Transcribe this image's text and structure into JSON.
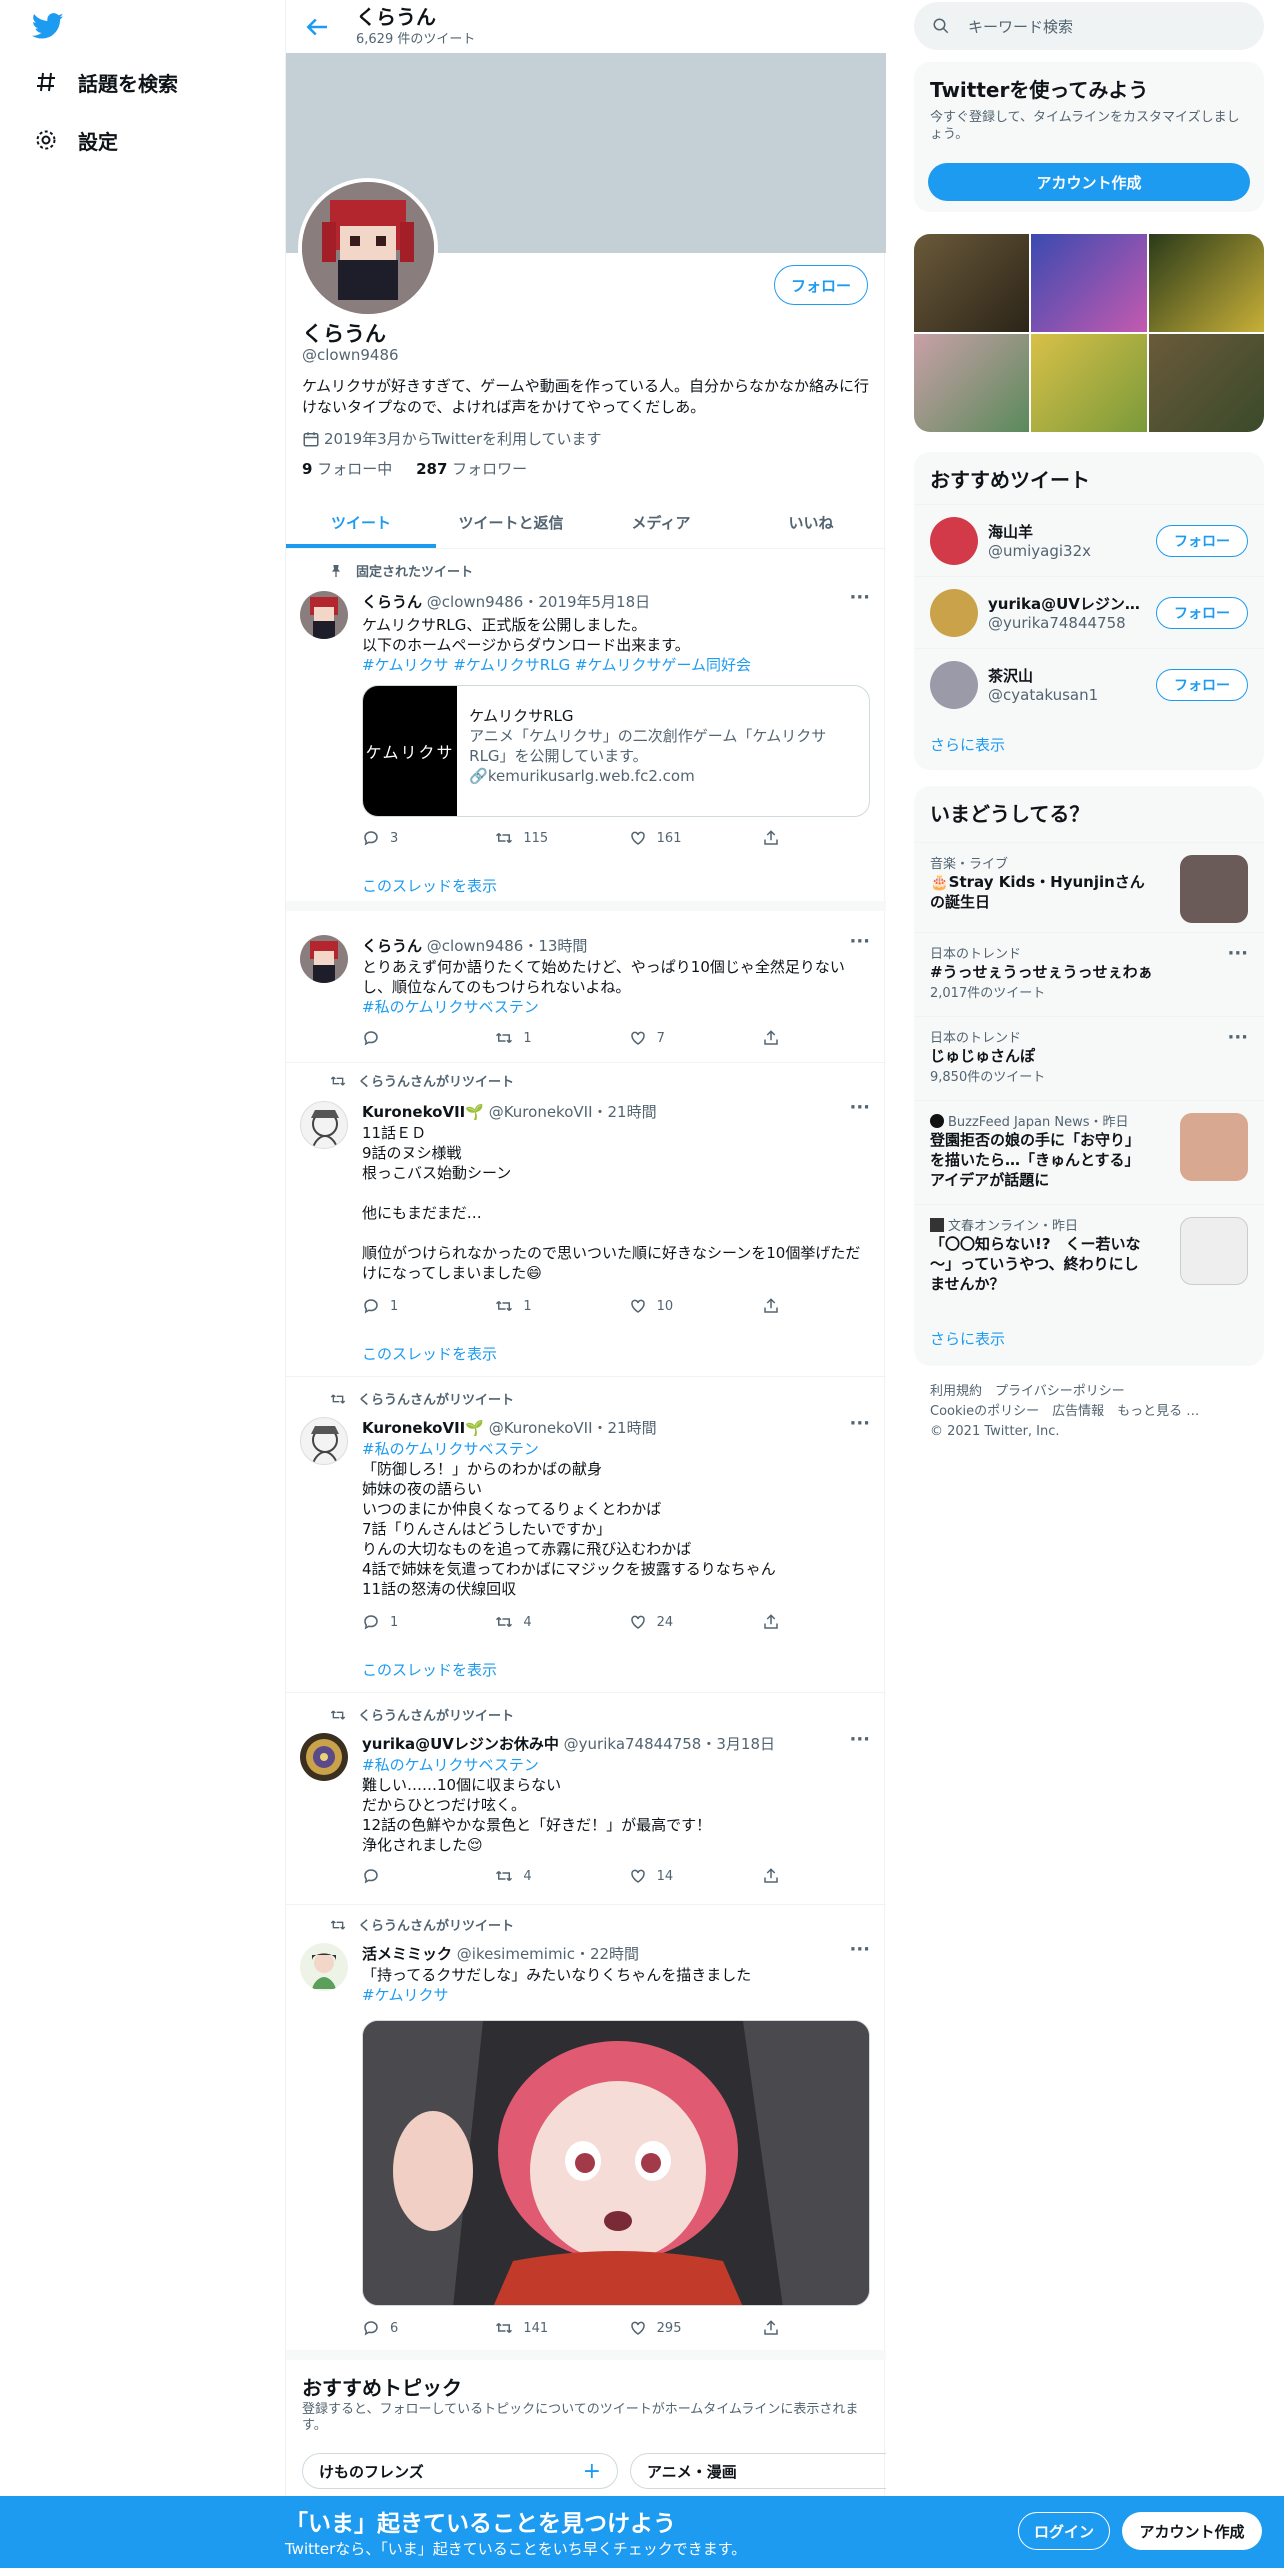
{
  "nav": {
    "explore_label": "話題を検索",
    "settings_label": "設定"
  },
  "profile_header": {
    "name": "くらうん",
    "tweet_count": "6,629 件のツイート"
  },
  "profile": {
    "follow_label": "フォロー",
    "name": "くらうん",
    "handle": "@clown9486",
    "bio": "ケムリクサが好きすぎて、ゲームや動画を作っている人。自分からなかなか絡みに行けないタイプなので、よければ声をかけてやってくだしあ。",
    "joined": "2019年3月からTwitterを利用しています",
    "following_count": "9",
    "following_label": "フォロー中",
    "followers_count": "287",
    "followers_label": "フォロワー"
  },
  "tabs": [
    "ツイート",
    "ツイートと返信",
    "メディア",
    "いいね"
  ],
  "tweets": [
    {
      "context": "固定されたツイート",
      "name": "くらうん",
      "meta": "@clown9486・2019年5月18日",
      "text": "ケムリクサRLG、正式版を公開しました。\n以下のホームページからダウンロード出来ます。",
      "tags": "#ケムリクサ #ケムリクサRLG #ケムリクサゲーム同好会",
      "card": {
        "img_text": "ケムリクサ",
        "title": "ケムリクサRLG",
        "desc": "アニメ「ケムリクサ」の二次創作ゲーム「ケムリクサRLG」を公開しています。",
        "url": "kemurikusarlg.web.fc2.com"
      },
      "replies": "3",
      "retweets": "115",
      "likes": "161",
      "thread": "このスレッドを表示"
    },
    {
      "name": "くらうん",
      "meta": "@clown9486・13時間",
      "text": "とりあえず何か語りたくて始めたけど、やっぱり10個じゃ全然足りないし、順位なんてのもつけられないよね。",
      "tags": "#私のケムリクサベステン",
      "replies": "",
      "retweets": "1",
      "likes": "7"
    },
    {
      "context": "くらうんさんがリツイート",
      "name": "KuronekoVII🌱",
      "meta": "@KuronekoVII・21時間",
      "text": "11話ＥＤ\n9話のヌシ様戦\n根っこバス始動シーン\n\n他にもまだまだ…\n\n順位がつけられなかったので思いついた順に好きなシーンを10個挙げただけになってしまいました😄",
      "replies": "1",
      "retweets": "1",
      "likes": "10",
      "thread": "このスレッドを表示"
    },
    {
      "context": "くらうんさんがリツイート",
      "name": "KuronekoVII🌱",
      "meta": "@KuronekoVII・21時間",
      "tags": "#私のケムリクサベステン",
      "text": "「防御しろ！」からのわかばの献身\n姉妹の夜の語らい\nいつのまにか仲良くなってるりょくとわかば\n7話「りんさんはどうしたいですか」\nりんの大切なものを追って赤霧に飛び込むわかば\n4話で姉妹を気遣ってわかばにマジックを披露するりなちゃん\n11話の怒涛の伏線回収",
      "replies": "1",
      "retweets": "4",
      "likes": "24",
      "thread": "このスレッドを表示"
    },
    {
      "context": "くらうんさんがリツイート",
      "name": "yurika@UVレジンお休み中",
      "meta": "@yurika74844758・3月18日",
      "tags": "#私のケムリクサベステン",
      "text": "難しい……10個に収まらない\nだからひとつだけ呟く。\n12話の色鮮やかな景色と「好きだ！」が最高です！\n浄化されました😌",
      "replies": "",
      "retweets": "4",
      "likes": "14"
    },
    {
      "context": "くらうんさんがリツイート",
      "name": "活メミミック",
      "meta": "@ikesimemimic・22時間",
      "text": "「持ってるクサだしな」みたいなりくちゃんを描きました",
      "tags": "#ケムリクサ",
      "replies": "6",
      "retweets": "141",
      "likes": "295"
    }
  ],
  "topics": {
    "title": "おすすめトピック",
    "subtitle": "登録すると、フォローしているトピックについてのツイートがホームタイムラインに表示されます。",
    "items": [
      "けものフレンズ",
      "アニメ・漫画"
    ]
  },
  "search": {
    "placeholder": "キーワード検索"
  },
  "signup": {
    "title": "Twitterを使ってみよう",
    "subtitle": "今すぐ登録して、タイムラインをカスタマイズしましょう。",
    "button": "アカウント作成"
  },
  "who_to_follow": {
    "title": "おすすめツイート",
    "users": [
      {
        "name": "海山羊",
        "handle": "@umiyagi32x"
      },
      {
        "name": "yurika@UVレジンお...",
        "handle": "@yurika74844758"
      },
      {
        "name": "茶沢山",
        "handle": "@cyatakusan1"
      }
    ],
    "follow_label": "フォロー",
    "show_more": "さらに表示"
  },
  "trends": {
    "title": "いまどうしてる？",
    "items": [
      {
        "meta": "音楽・ライブ",
        "name": "🎂Stray Kids・Hyunjinさんの誕生日"
      },
      {
        "meta": "日本のトレンド",
        "name": "#うっせぇうっせぇうっせぇわぁ",
        "count": "2,017件のツイート"
      },
      {
        "meta": "日本のトレンド",
        "name": "じゅじゅさんぽ",
        "count": "9,850件のツイート"
      },
      {
        "meta": "BuzzFeed Japan News・昨日",
        "name": "登園拒否の娘の手に「お守り」を描いたら…「きゅんとする」アイデアが話題に"
      },
      {
        "meta": "文春オンライン・昨日",
        "name": "「〇〇知らない!?　くー若いな～」っていうやつ、終わりにしませんか？"
      }
    ],
    "show_more": "さらに表示"
  },
  "footer": {
    "line1": "利用規約　プライバシーポリシー",
    "line2": "Cookieのポリシー　広告情報　もっと見る …",
    "line3": "© 2021 Twitter, Inc."
  },
  "bottom_bar": {
    "title": "「いま」起きていることを見つけよう",
    "subtitle": "Twitterなら、「いま」起きていることをいち早くチェックできます。",
    "login": "ログイン",
    "register": "アカウント作成"
  },
  "colors": {
    "accent": "#1d9bf0",
    "banner": "#c4cfd6"
  }
}
